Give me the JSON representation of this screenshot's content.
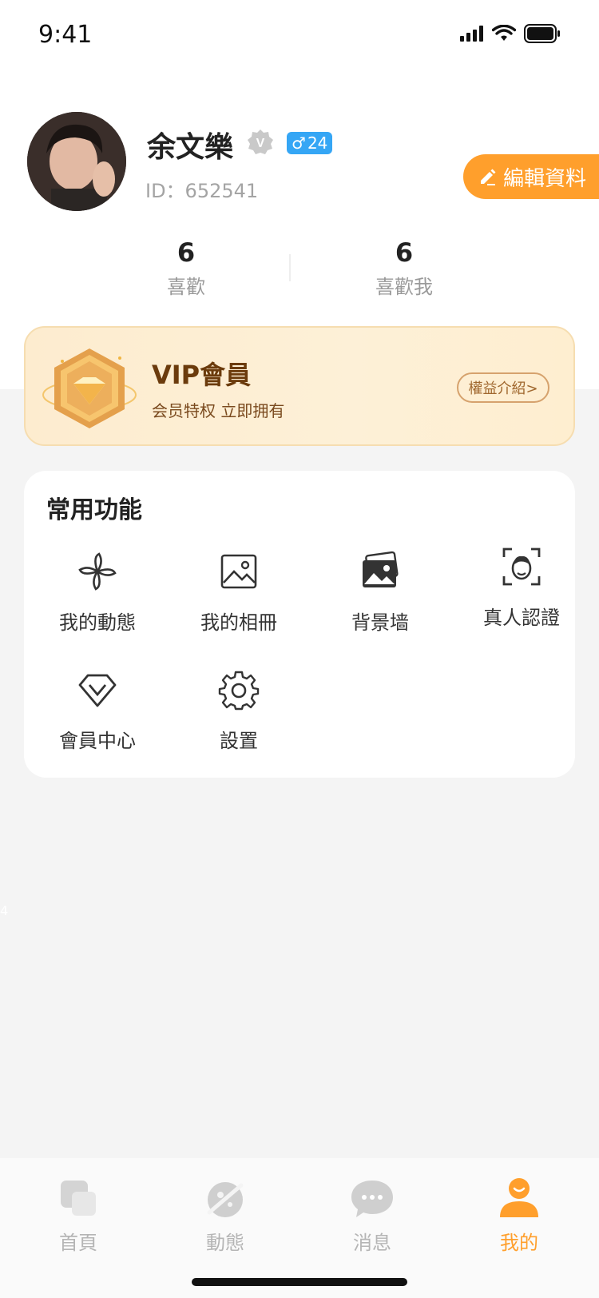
{
  "status_bar": {
    "time": "9:41"
  },
  "profile": {
    "name": "余文樂",
    "gender_age": "24",
    "user_id": "ID：652541",
    "edit_label": "編輯資料"
  },
  "stats": [
    {
      "value": "6",
      "label": "喜歡"
    },
    {
      "value": "6",
      "label": "喜歡我"
    }
  ],
  "vip": {
    "title": "VIP會員",
    "subtitle": "会员特权 立即拥有",
    "benefits_label": "權益介紹>"
  },
  "functions": {
    "title": "常用功能",
    "items": [
      {
        "label": "我的動態",
        "icon": "pinwheel-icon"
      },
      {
        "label": "我的相冊",
        "icon": "image-icon"
      },
      {
        "label": "背景墙",
        "icon": "photos-icon"
      },
      {
        "label": "真人認證",
        "icon": "face-scan-icon"
      },
      {
        "label": "會員中心",
        "icon": "diamond-icon"
      },
      {
        "label": "設置",
        "icon": "gear-icon"
      }
    ]
  },
  "side_number": "4",
  "bottom_nav": {
    "items": [
      {
        "label": "首頁",
        "icon": "home-icon"
      },
      {
        "label": "動態",
        "icon": "planet-icon"
      },
      {
        "label": "消息",
        "icon": "chat-bubble-icon"
      },
      {
        "label": "我的",
        "icon": "person-icon",
        "active": true
      }
    ]
  },
  "colors": {
    "accent": "#ff9f2c",
    "vip_text": "#6b3b0c",
    "badge_blue": "#35a6f5"
  }
}
